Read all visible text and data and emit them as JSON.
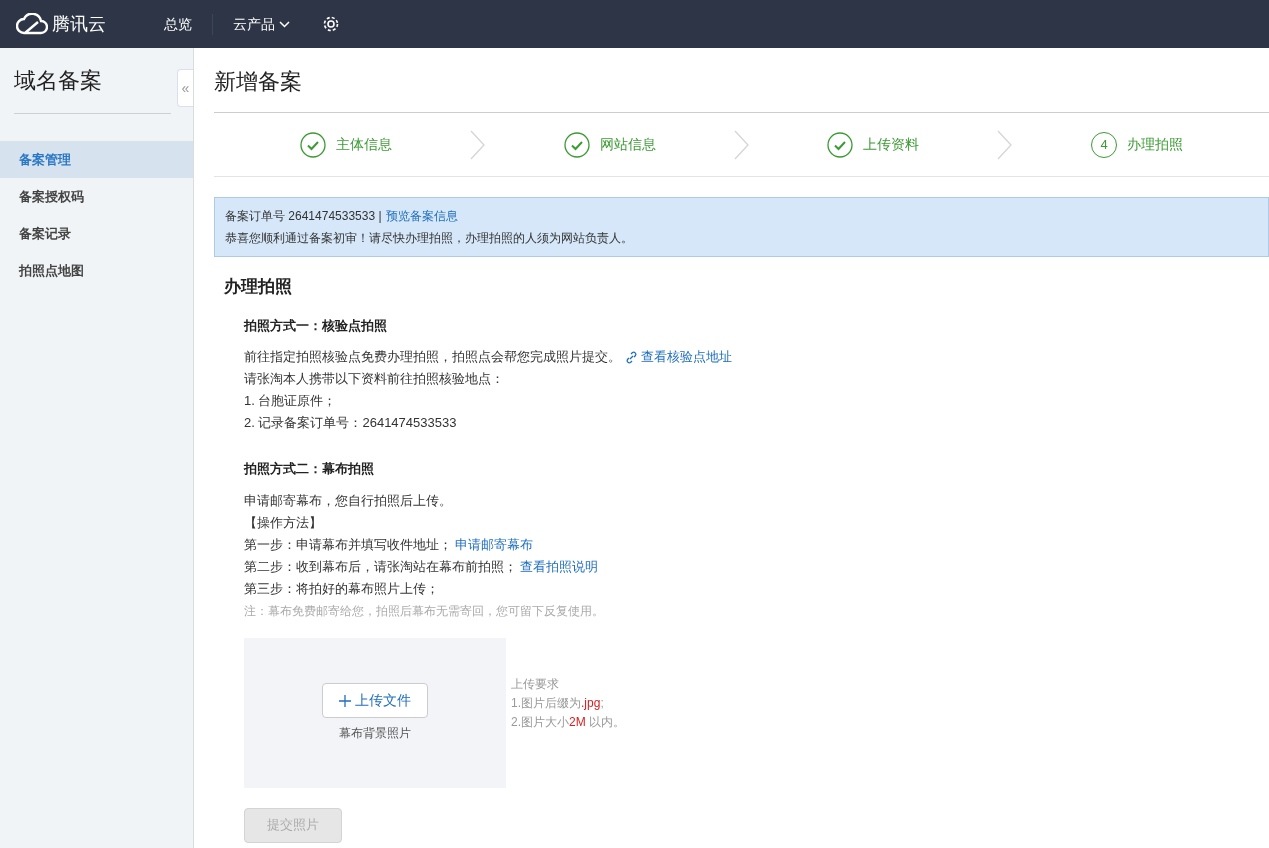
{
  "topbar": {
    "logo": "腾讯云",
    "nav": [
      {
        "label": "总览",
        "dropdown": false
      },
      {
        "label": "云产品",
        "dropdown": true
      }
    ]
  },
  "sidebar": {
    "title": "域名备案",
    "collapse": "«",
    "items": [
      {
        "label": "备案管理",
        "selected": true
      },
      {
        "label": "备案授权码",
        "selected": false
      },
      {
        "label": "备案记录",
        "selected": false
      },
      {
        "label": "拍照点地图",
        "selected": false
      }
    ]
  },
  "page_title": "新增备案",
  "steps": [
    {
      "label": "主体信息",
      "done": true
    },
    {
      "label": "网站信息",
      "done": true
    },
    {
      "label": "上传资料",
      "done": true
    },
    {
      "label": "办理拍照",
      "done": false,
      "number": "4"
    }
  ],
  "notice": {
    "order_label": "备案订单号 2641474533533 |",
    "order_link": "预览备案信息",
    "message": "恭喜您顺利通过备案初审！请尽快办理拍照，办理拍照的人须为网站负责人。"
  },
  "section_title": "办理拍照",
  "methods": [
    {
      "title": "拍照方式一：核验点拍照",
      "lines": [
        {
          "text": "前往指定拍照核验点免费办理拍照，拍照点会帮您完成照片提交。",
          "link": "查看核验点地址",
          "link_icon": true
        },
        {
          "text": "请张淘本人携带以下资料前往拍照核验地点："
        },
        {
          "text": "1. 台胞证原件；"
        },
        {
          "text": "2. 记录备案订单号：2641474533533"
        }
      ]
    },
    {
      "title": "拍照方式二：幕布拍照",
      "lines": [
        {
          "text": "申请邮寄幕布，您自行拍照后上传。"
        },
        {
          "text": "【操作方法】"
        },
        {
          "text": "第一步：申请幕布并填写收件地址；",
          "link": "申请邮寄幕布",
          "link_icon": false
        },
        {
          "text": "第二步：收到幕布后，请张淘站在幕布前拍照；",
          "link": "查看拍照说明",
          "link_icon": false
        },
        {
          "text": "第三步：将拍好的幕布照片上传；"
        }
      ],
      "note": "注：幕布免费邮寄给您，拍照后幕布无需寄回，您可留下反复使用。"
    }
  ],
  "upload": {
    "button": "上传文件",
    "caption": "幕布背景照片",
    "requirements_title": "上传要求",
    "requirements": [
      [
        {
          "text": "1.图片后缀为",
          "highlight": false
        },
        {
          "text": ".jpg",
          "highlight": true
        },
        {
          "text": ";",
          "highlight": false
        }
      ],
      [
        {
          "text": "2.图片大小",
          "highlight": false
        },
        {
          "text": "2M",
          "highlight": true
        },
        {
          "text": " 以内。",
          "highlight": false
        }
      ]
    ]
  },
  "submit": {
    "label": "提交照片",
    "disabled": true
  }
}
